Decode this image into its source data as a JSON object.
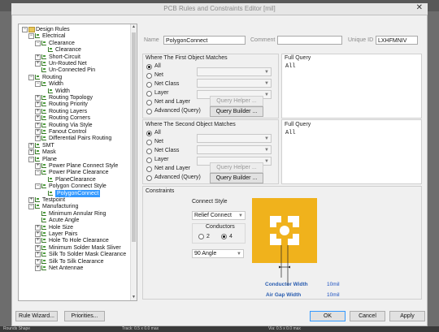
{
  "window": {
    "title": "PCB Rules and Constraints Editor [mil]",
    "close_glyph": "✕"
  },
  "tree": {
    "items": [
      {
        "label": "Design Rules",
        "level": 0,
        "icon": "folder-icon",
        "expand": "−",
        "selected": false
      },
      {
        "label": "Electrical",
        "level": 1,
        "icon": "rule-icon",
        "expand": "−",
        "selected": false
      },
      {
        "label": "Clearance",
        "level": 2,
        "icon": "rule-icon",
        "expand": "−",
        "selected": false
      },
      {
        "label": "Clearance",
        "level": 3,
        "icon": "rule-icon",
        "expand": "",
        "selected": false
      },
      {
        "label": "Short-Circuit",
        "level": 2,
        "icon": "rule-icon",
        "expand": "+",
        "selected": false
      },
      {
        "label": "Un-Routed Net",
        "level": 2,
        "icon": "rule-icon",
        "expand": "+",
        "selected": false
      },
      {
        "label": "Un-Connected Pin",
        "level": 2,
        "icon": "rule-icon",
        "expand": "",
        "selected": false
      },
      {
        "label": "Routing",
        "level": 1,
        "icon": "rule-icon",
        "expand": "−",
        "selected": false
      },
      {
        "label": "Width",
        "level": 2,
        "icon": "rule-icon",
        "expand": "−",
        "selected": false
      },
      {
        "label": "Width",
        "level": 3,
        "icon": "rule-icon",
        "expand": "",
        "selected": false
      },
      {
        "label": "Routing Topology",
        "level": 2,
        "icon": "rule-icon",
        "expand": "+",
        "selected": false
      },
      {
        "label": "Routing Priority",
        "level": 2,
        "icon": "rule-icon",
        "expand": "+",
        "selected": false
      },
      {
        "label": "Routing Layers",
        "level": 2,
        "icon": "rule-icon",
        "expand": "+",
        "selected": false
      },
      {
        "label": "Routing Corners",
        "level": 2,
        "icon": "rule-icon",
        "expand": "+",
        "selected": false
      },
      {
        "label": "Routing Via Style",
        "level": 2,
        "icon": "rule-icon",
        "expand": "+",
        "selected": false
      },
      {
        "label": "Fanout Control",
        "level": 2,
        "icon": "rule-icon",
        "expand": "+",
        "selected": false
      },
      {
        "label": "Differential Pairs Routing",
        "level": 2,
        "icon": "rule-icon",
        "expand": "+",
        "selected": false
      },
      {
        "label": "SMT",
        "level": 1,
        "icon": "rule-icon",
        "expand": "+",
        "selected": false
      },
      {
        "label": "Mask",
        "level": 1,
        "icon": "rule-icon",
        "expand": "+",
        "selected": false
      },
      {
        "label": "Plane",
        "level": 1,
        "icon": "rule-icon",
        "expand": "−",
        "selected": false
      },
      {
        "label": "Power Plane Connect Style",
        "level": 2,
        "icon": "rule-icon",
        "expand": "+",
        "selected": false
      },
      {
        "label": "Power Plane Clearance",
        "level": 2,
        "icon": "rule-icon",
        "expand": "−",
        "selected": false
      },
      {
        "label": "PlaneClearance",
        "level": 3,
        "icon": "rule-icon",
        "expand": "",
        "selected": false
      },
      {
        "label": "Polygon Connect Style",
        "level": 2,
        "icon": "rule-icon",
        "expand": "−",
        "selected": false
      },
      {
        "label": "PolygonConnect",
        "level": 3,
        "icon": "rule-icon",
        "expand": "",
        "selected": true
      },
      {
        "label": "Testpoint",
        "level": 1,
        "icon": "rule-icon",
        "expand": "+",
        "selected": false
      },
      {
        "label": "Manufacturing",
        "level": 1,
        "icon": "rule-icon",
        "expand": "−",
        "selected": false
      },
      {
        "label": "Minimum Annular Ring",
        "level": 2,
        "icon": "rule-icon",
        "expand": "",
        "selected": false
      },
      {
        "label": "Acute Angle",
        "level": 2,
        "icon": "rule-icon",
        "expand": "",
        "selected": false
      },
      {
        "label": "Hole Size",
        "level": 2,
        "icon": "rule-icon",
        "expand": "+",
        "selected": false
      },
      {
        "label": "Layer Pairs",
        "level": 2,
        "icon": "rule-icon",
        "expand": "+",
        "selected": false
      },
      {
        "label": "Hole To Hole Clearance",
        "level": 2,
        "icon": "rule-icon",
        "expand": "+",
        "selected": false
      },
      {
        "label": "Minimum Solder Mask Sliver",
        "level": 2,
        "icon": "rule-icon",
        "expand": "+",
        "selected": false
      },
      {
        "label": "Silk To Solder Mask Clearance",
        "level": 2,
        "icon": "rule-icon",
        "expand": "+",
        "selected": false
      },
      {
        "label": "Silk To Silk Clearance",
        "level": 2,
        "icon": "rule-icon",
        "expand": "+",
        "selected": false
      },
      {
        "label": "Net Antennae",
        "level": 2,
        "icon": "rule-icon",
        "expand": "+",
        "selected": false
      }
    ]
  },
  "header": {
    "name_label": "Name",
    "name_value": "PolygonConnect",
    "comment_label": "Comment",
    "comment_value": "",
    "uid_label": "Unique ID",
    "uid_value": "LXHFMNIV"
  },
  "first_match": {
    "title": "Where The First Object Matches",
    "options": [
      "All",
      "Net",
      "Net Class",
      "Layer",
      "Net and Layer",
      "Advanced (Query)"
    ],
    "selected_index": 0,
    "query_helper": "Query Helper ...",
    "query_builder": "Query Builder ...",
    "full_query_label": "Full Query",
    "full_query": "All"
  },
  "second_match": {
    "title": "Where The Second Object Matches",
    "options": [
      "All",
      "Net",
      "Net Class",
      "Layer",
      "Net and Layer",
      "Advanced (Query)"
    ],
    "selected_index": 0,
    "query_helper": "Query Helper ...",
    "query_builder": "Query Builder ...",
    "full_query_label": "Full Query",
    "full_query": "All"
  },
  "constraints": {
    "title": "Constraints",
    "connect_style_label": "Connect Style",
    "connect_style_value": "Relief Connect",
    "conductors_label": "Conductors",
    "conductor_options": [
      "2",
      "4"
    ],
    "conductor_selected": "4",
    "angle_value": "90 Angle",
    "conductor_width_label": "Conductor Width",
    "conductor_width_value": "10mil",
    "air_gap_label": "Air Gap Width",
    "air_gap_value": "10mil",
    "pad_color": "#f0b21c"
  },
  "footer": {
    "rule_wizard": "Rule Wizard...",
    "priorities": "Priorities...",
    "ok": "OK",
    "cancel": "Cancel",
    "apply": "Apply"
  },
  "taskbar_fragments": [
    "Rounds Shape",
    "Track: 0.5 x 0.0 max",
    "Via: 0.5 x 0.0 max"
  ]
}
